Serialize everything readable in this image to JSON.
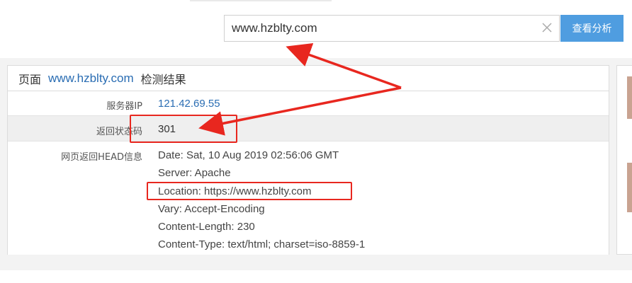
{
  "search": {
    "value": "www.hzblty.com",
    "button_label": "查看分析"
  },
  "result_panel": {
    "header_prefix": "页面",
    "header_url": "www.hzblty.com",
    "header_suffix": "检测结果",
    "rows": {
      "ip": {
        "label": "服务器IP",
        "value": "121.42.69.55"
      },
      "status": {
        "label": "返回状态码",
        "value": "301"
      },
      "head": {
        "label": "网页返回HEAD信息",
        "lines": [
          "Date: Sat, 10 Aug 2019 02:56:06 GMT",
          "Server: Apache",
          "Location: https://www.hzblty.com",
          "Vary: Accept-Encoding",
          "Content-Length: 230",
          "Content-Type: text/html; charset=iso-8859-1"
        ]
      }
    }
  },
  "colors": {
    "accent_button": "#4f9de0",
    "link_blue": "#2a6db3",
    "annotation_red": "#e8271f"
  },
  "icons": {
    "clear": "close-icon"
  }
}
